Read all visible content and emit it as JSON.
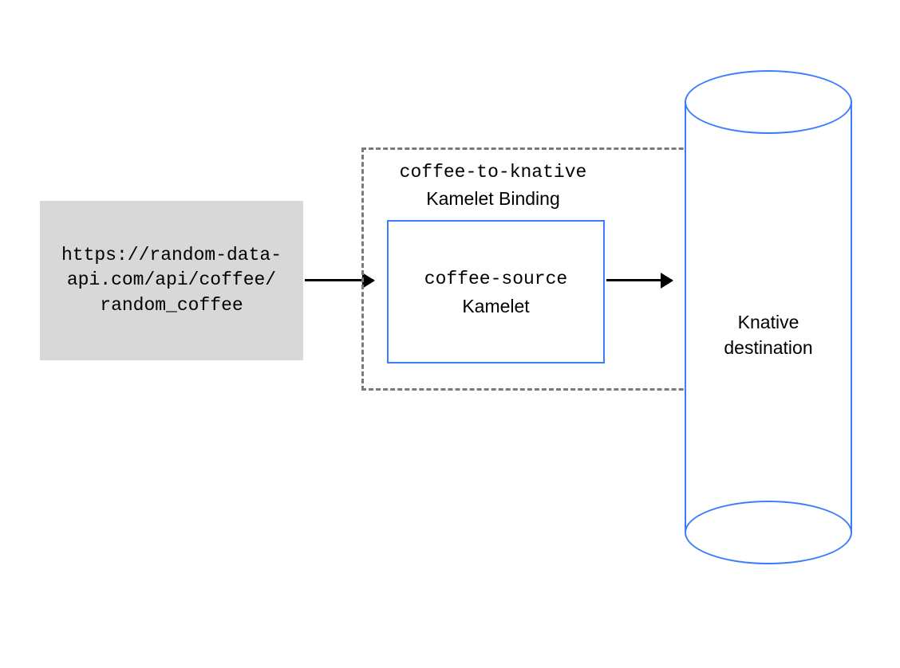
{
  "source": {
    "url_line1": "https://random-data-",
    "url_line2": "api.com/api/coffee/",
    "url_line3": "random_coffee"
  },
  "binding": {
    "name": "coffee-to-knative",
    "type_label": "Kamelet Binding"
  },
  "kamelet": {
    "name": "coffee-source",
    "type_label": "Kamelet"
  },
  "destination": {
    "line1": "Knative",
    "line2": "destination"
  },
  "colors": {
    "accent_blue": "#3b7cff",
    "grey_fill": "#d8d8d8",
    "dashed_grey": "#7a7a7a"
  }
}
